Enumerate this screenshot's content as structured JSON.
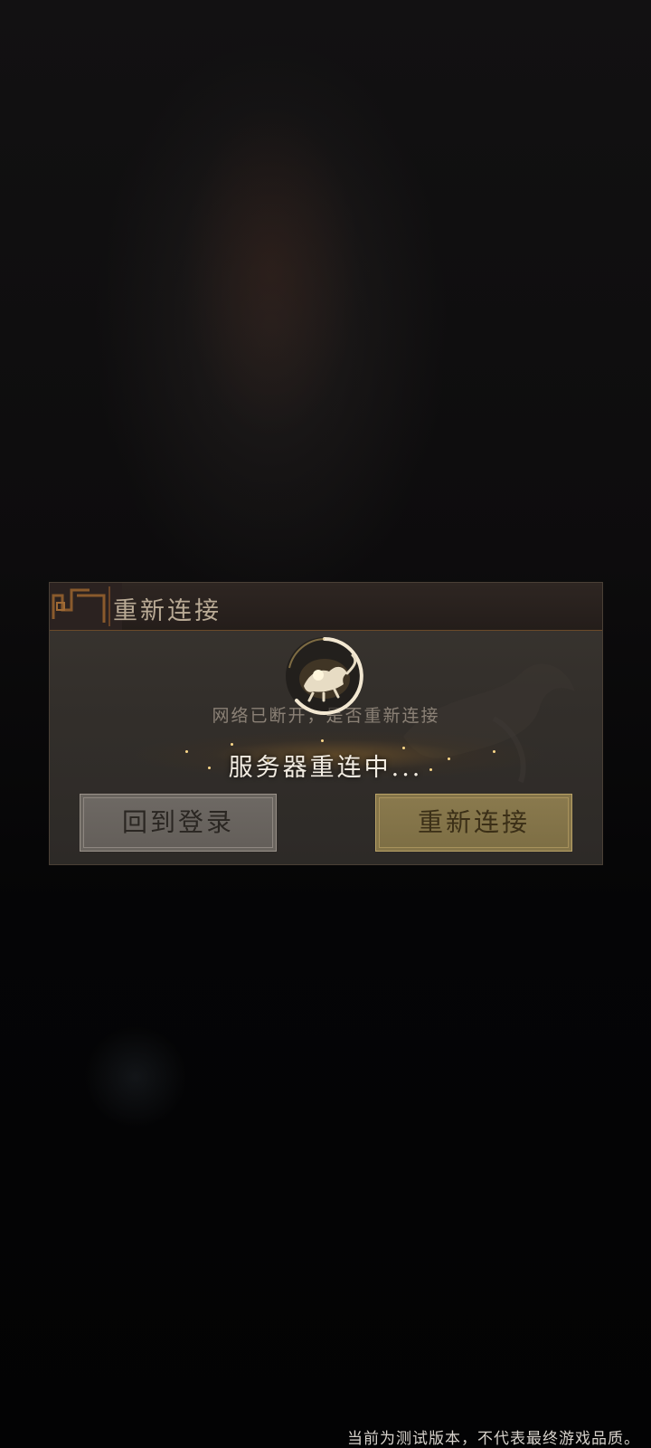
{
  "dialog": {
    "title": "重新连接",
    "message": "网络已断开，是否重新连接",
    "back_button_label": "回到登录",
    "reconnect_button_label": "重新连接"
  },
  "loading": {
    "status_text": "服务器重连中...",
    "icon": "tiger-emblem-spinner-icon"
  },
  "footer": {
    "disclaimer": "当前为测试版本，不代表最终游戏品质。"
  },
  "colors": {
    "background": "#050506",
    "dialog_bg": "#332f2b",
    "title_text": "#b9aa95",
    "reconnect_button": "#8a7a4e",
    "back_button": "#6e6964",
    "accent_gold": "#d9b86a"
  }
}
